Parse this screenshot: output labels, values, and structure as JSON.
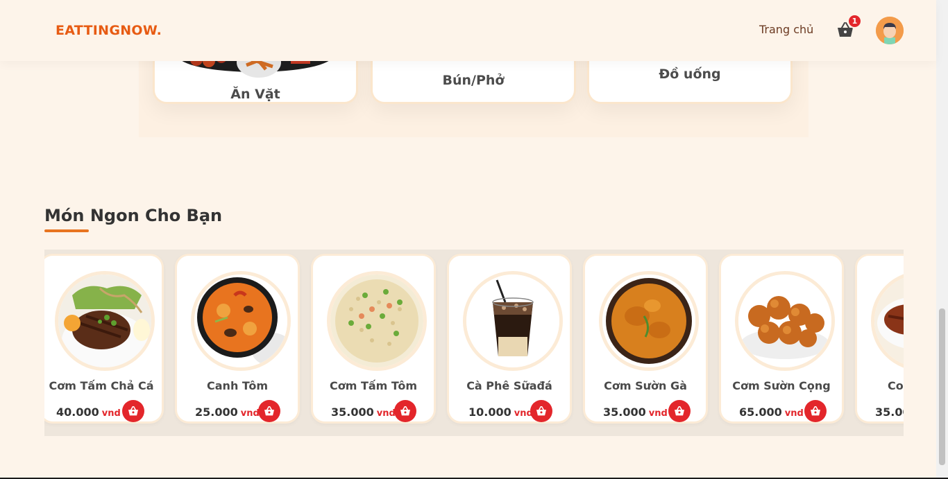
{
  "header": {
    "logo": "EATTINGNOW.",
    "nav_home": "Trang chủ",
    "cart_count": "1"
  },
  "categories": [
    {
      "label": "Ăn Vặt"
    },
    {
      "label": "Bún/Phở"
    },
    {
      "label": "Đồ uống"
    }
  ],
  "section": {
    "title": "Món Ngon Cho Bạn"
  },
  "products": [
    {
      "name": "Cơm Tấm Chả Cá",
      "price": "40.000",
      "unit": "vnd"
    },
    {
      "name": "Canh Tôm",
      "price": "25.000",
      "unit": "vnd"
    },
    {
      "name": "Cơm Tấm Tôm",
      "price": "35.000",
      "unit": "vnd"
    },
    {
      "name": "Cà Phê Sữađá",
      "price": "10.000",
      "unit": "vnd"
    },
    {
      "name": "Cơm Sườn Gà",
      "price": "35.000",
      "unit": "vnd"
    },
    {
      "name": "Cơm Sườn Cọng",
      "price": "65.000",
      "unit": "vnd"
    },
    {
      "name": "Co",
      "price": "35.00",
      "unit": ""
    }
  ],
  "colors": {
    "accent": "#e75b13",
    "badge": "#e3262b",
    "background": "#fdf4ea"
  }
}
